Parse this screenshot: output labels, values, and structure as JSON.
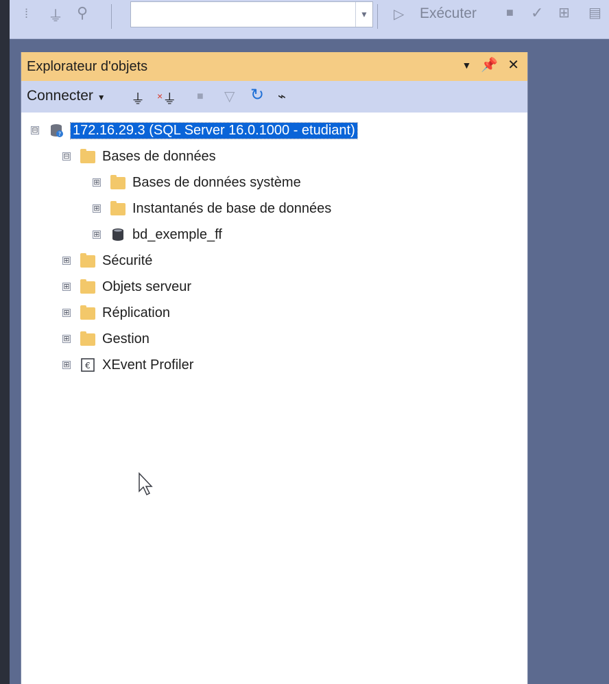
{
  "toolbar": {
    "execute_label": "Exécuter",
    "combo_value": ""
  },
  "explorer": {
    "title": "Explorateur d'objets",
    "connect_label": "Connecter",
    "tree": {
      "server": "172.16.29.3 (SQL Server 16.0.1000 - etudiant)",
      "databases": "Bases de données",
      "system_databases": "Bases de données système",
      "snapshots": "Instantanés de base de données",
      "db_user": "bd_exemple_ff",
      "security": "Sécurité",
      "server_objects": "Objets serveur",
      "replication": "Réplication",
      "management": "Gestion",
      "xevent": "XEvent Profiler"
    }
  },
  "icons": {
    "expand": "⊞",
    "collapse": "⊟"
  },
  "colors": {
    "title_bar": "#f5cc84",
    "toolbar": "#ccd5f0",
    "selection": "#0a64d8",
    "background": "#5c6a8f"
  }
}
